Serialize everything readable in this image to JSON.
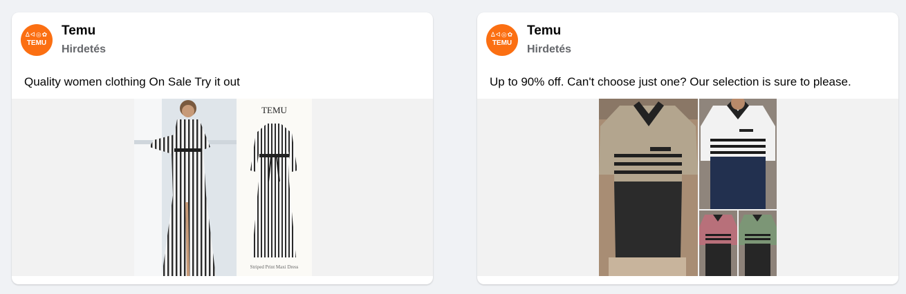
{
  "posts": [
    {
      "advertiser": "Temu",
      "label": "Hirdetés",
      "avatar": {
        "brand": "TEMU",
        "glyphs": "ᐃᐊ◎✿",
        "color": "#fb6f12"
      },
      "caption": "Quality women clothing On Sale Try it out",
      "media": {
        "product_brand": "TEMU",
        "product_caption": "Striped Print Maxi Dress"
      }
    },
    {
      "advertiser": "Temu",
      "label": "Hirdetés",
      "avatar": {
        "brand": "TEMU",
        "glyphs": "ᐃᐊ◎✿",
        "color": "#fb6f12"
      },
      "caption": "Up to 90% off. Can't choose just one? Our selection is sure to please.",
      "media": {}
    }
  ]
}
